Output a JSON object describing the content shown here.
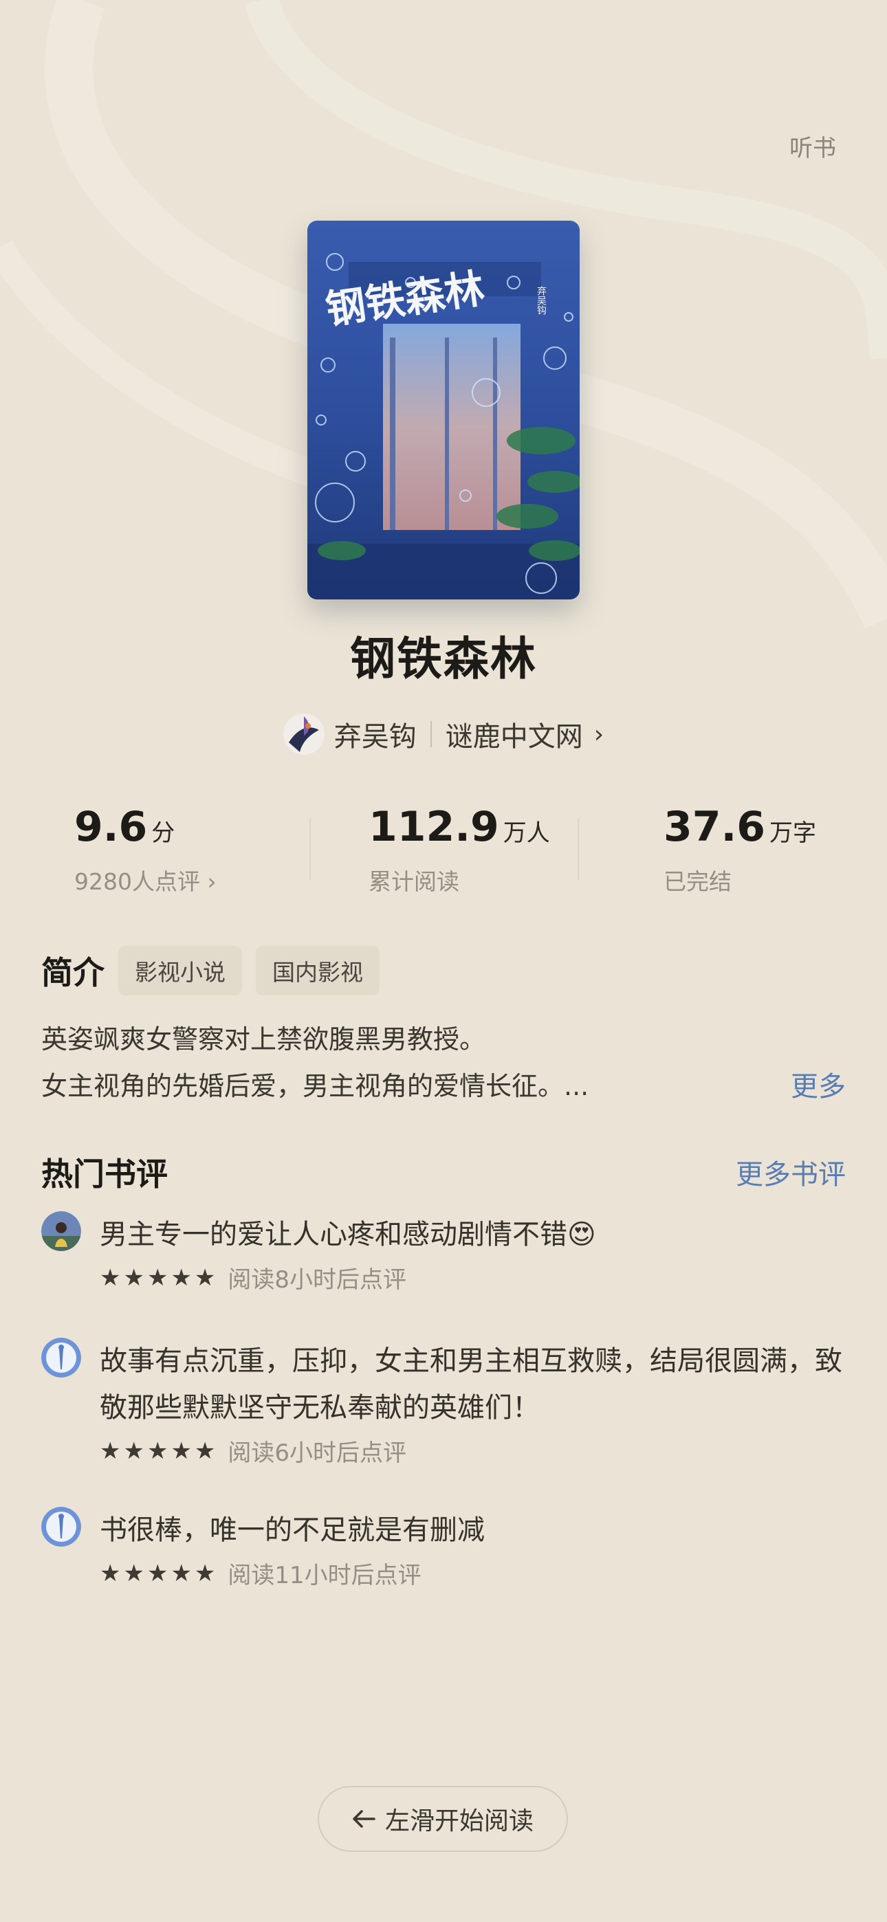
{
  "header": {
    "listen_label": "听书"
  },
  "book": {
    "title": "钢铁森林",
    "cover_title": "钢铁森林",
    "author": "弃吴钩",
    "publisher": "谜鹿中文网"
  },
  "stats": {
    "rating": {
      "value": "9.6",
      "unit": "分",
      "sub": "9280人点评"
    },
    "readers": {
      "value": "112.9",
      "unit": "万人",
      "sub": "累计阅读"
    },
    "words": {
      "value": "37.6",
      "unit": "万字",
      "sub": "已完结"
    }
  },
  "intro": {
    "title": "简介",
    "tags": [
      "影视小说",
      "国内影视"
    ],
    "lines": [
      "英姿飒爽女警察对上禁欲腹黑男教授。",
      "女主视角的先婚后爱，男主视角的爱情长征。..."
    ],
    "more_label": "更多"
  },
  "reviews": {
    "title": "热门书评",
    "more_label": "更多书评",
    "items": [
      {
        "text": "男主专一的爱让人心疼和感动剧情不错😍",
        "stars": "★★★★★",
        "stars_value": 5,
        "time": "阅读8小时后点评"
      },
      {
        "text": "故事有点沉重，压抑，女主和男主相互救赎，结局很圆满，致敬那些默默坚守无私奉献的英雄们！",
        "stars": "★★★★★",
        "stars_value": 5,
        "time": "阅读6小时后点评"
      },
      {
        "text": "书很棒，唯一的不足就是有删减",
        "stars": "★★★★★",
        "stars_value": 5,
        "time": "阅读11小时后点评"
      }
    ]
  },
  "footer": {
    "read_label": "左滑开始阅读",
    "arrow_icon": "arrow-left-icon"
  },
  "colors": {
    "background": "#ebe4d6",
    "link": "#5a7db0",
    "cover_blue": "#2e4f9e"
  }
}
